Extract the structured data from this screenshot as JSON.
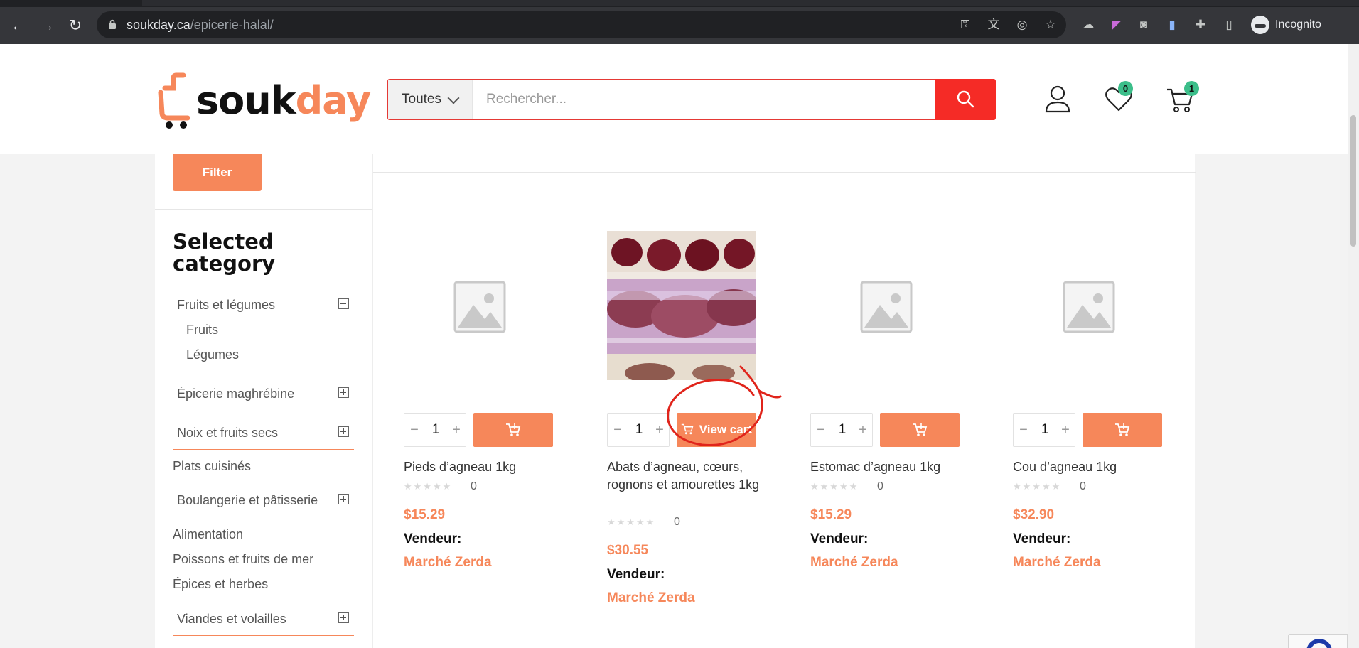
{
  "browser": {
    "url_host": "soukday.ca",
    "url_path": "/epicerie-halal/",
    "profile_label": "Incognito"
  },
  "header": {
    "logo_part1": "souk",
    "logo_part2": "day",
    "search_category": "Toutes",
    "search_placeholder": "Rechercher...",
    "wishlist_count": "0",
    "cart_count": "1"
  },
  "sidebar": {
    "filter_label": "Filter",
    "heading": "Selected category",
    "categories": [
      {
        "label": "Fruits et légumes"
      },
      {
        "label": "Fruits"
      },
      {
        "label": "Légumes"
      },
      {
        "label": "Épicerie maghrébine"
      },
      {
        "label": "Noix et fruits secs"
      },
      {
        "label": "Plats cuisinés"
      },
      {
        "label": "Boulangerie et pâtisserie"
      },
      {
        "label": "Alimentation"
      },
      {
        "label": "Poissons et fruits de mer"
      },
      {
        "label": "Épices et herbes"
      },
      {
        "label": "Viandes et volailles"
      }
    ]
  },
  "products": [
    {
      "name": "Pieds d’agneau 1kg",
      "qty": "1",
      "rating_count": "0",
      "price": "$15.29",
      "vendor_label": "Vendeur:",
      "vendor": "Marché Zerda"
    },
    {
      "name": "Abats d’agneau, cœurs, rognons et amourettes 1kg",
      "qty": "1",
      "rating_count": "0",
      "price": "$30.55",
      "vendor_label": "Vendeur:",
      "vendor": "Marché Zerda",
      "button_label": "View cart"
    },
    {
      "name": "Estomac d’agneau 1kg",
      "qty": "1",
      "rating_count": "0",
      "price": "$15.29",
      "vendor_label": "Vendeur:",
      "vendor": "Marché Zerda"
    },
    {
      "name": "Cou d’agneau 1kg",
      "qty": "1",
      "rating_count": "0",
      "price": "$32.90",
      "vendor_label": "Vendeur:",
      "vendor": "Marché Zerda"
    }
  ],
  "colors": {
    "brand_orange": "#f6875a",
    "search_red": "#f52b26",
    "badge_green": "#3cbe8a",
    "annotation_red": "#e0241b"
  }
}
